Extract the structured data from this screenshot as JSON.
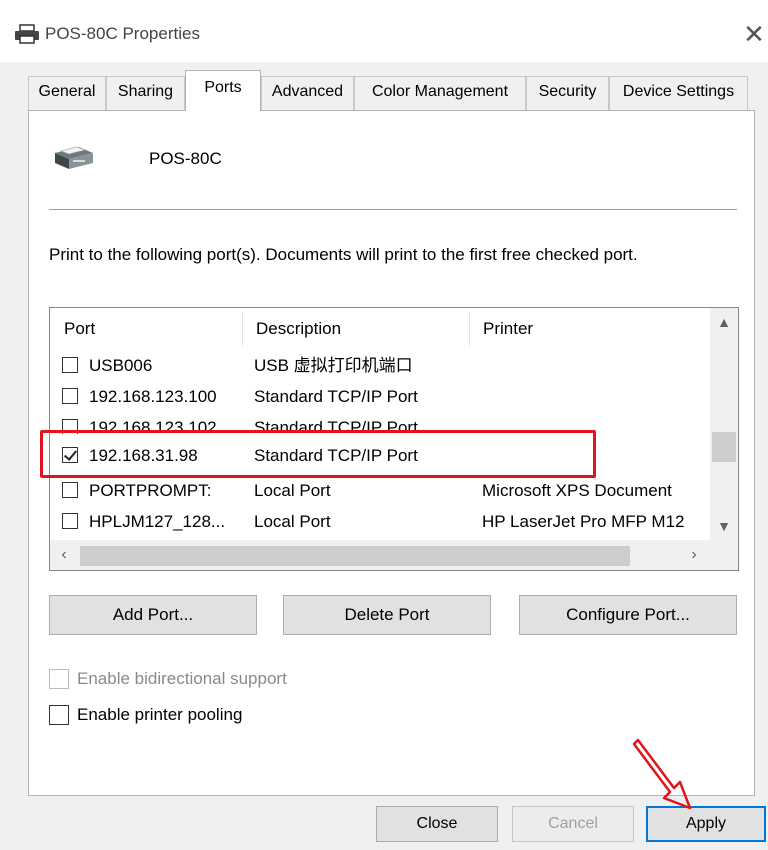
{
  "window": {
    "title": "POS-80C Properties",
    "close_glyph": "✕",
    "icon": "printer-icon"
  },
  "tabs": [
    {
      "label": "General"
    },
    {
      "label": "Sharing"
    },
    {
      "label": "Ports",
      "active": true
    },
    {
      "label": "Advanced"
    },
    {
      "label": "Color Management"
    },
    {
      "label": "Security"
    },
    {
      "label": "Device Settings"
    }
  ],
  "printer": {
    "name": "POS-80C"
  },
  "instructions": "Print to the following port(s). Documents will print to the first free checked port.",
  "port_list": {
    "columns": [
      "Port",
      "Description",
      "Printer"
    ],
    "rows": [
      {
        "checked": false,
        "port": "USB006",
        "description": "USB 虚拟打印机端口",
        "printer": ""
      },
      {
        "checked": false,
        "port": "192.168.123.100",
        "description": "Standard TCP/IP Port",
        "printer": ""
      },
      {
        "checked": false,
        "port": "192.168.123.102",
        "description": "Standard TCP/IP Port",
        "printer": ""
      },
      {
        "checked": true,
        "port": "192.168.31.98",
        "description": "Standard TCP/IP Port",
        "printer": ""
      },
      {
        "checked": false,
        "port": "PORTPROMPT:",
        "description": "Local Port",
        "printer": "Microsoft XPS Document"
      },
      {
        "checked": false,
        "port": "HPLJM127_128...",
        "description": "Local Port",
        "printer": "HP LaserJet Pro MFP M12"
      }
    ]
  },
  "port_buttons": {
    "add": "Add Port...",
    "delete": "Delete Port",
    "configure": "Configure Port..."
  },
  "options": {
    "bidirectional": {
      "label": "Enable bidirectional support",
      "checked": false,
      "disabled": true
    },
    "pooling": {
      "label": "Enable printer pooling",
      "checked": false,
      "disabled": false
    }
  },
  "dialog_buttons": {
    "close": "Close",
    "cancel": "Cancel",
    "apply": "Apply"
  },
  "colors": {
    "highlight": "#e0141e",
    "accent": "#0078d7"
  }
}
